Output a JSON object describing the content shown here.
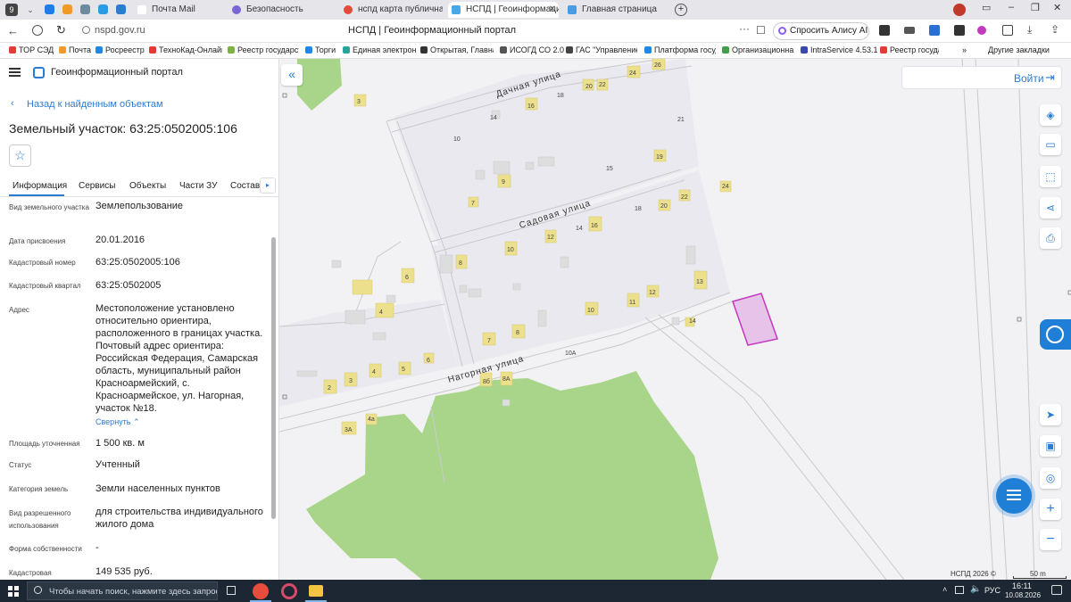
{
  "browser": {
    "tabs": [
      {
        "label": "Почта Mail",
        "color": "#1e7ee6"
      },
      {
        "label": "Безопасность",
        "color": "#7a66d6"
      },
      {
        "label": "нспд карта публичная ка",
        "color": "#e64a3a"
      },
      {
        "label": "НСПД | Геоинформаци",
        "color": "#4aa7e8"
      },
      {
        "label": "Главная страница",
        "color": "#4a9be0"
      }
    ],
    "address": "nspd.gov.ru",
    "page_title": "НСПД | Геоинформационный портал",
    "alice": "Спросить Алису AI",
    "bookmarks": [
      "ТОР СЭД",
      "Почта",
      "Росреестр",
      "ТехноКад-Онлайн",
      "Реестр государст",
      "Торги",
      "Единая электрон",
      "Открытая, Главна",
      "ИСОГД СО 2.0",
      "ГАС \"Управление",
      "Платформа госуд",
      "Организационна",
      "IntraService 4.53.1",
      "Реестр госуда"
    ],
    "bookmarks_more": "Другие закладки"
  },
  "panel": {
    "app_title": "Геоинформационный портал",
    "back": "Назад к найденным объектам",
    "object_title": "Земельный участок: 63:25:0502005:106",
    "tabs": [
      "Информация",
      "Сервисы",
      "Объекты",
      "Части ЗУ",
      "Состав"
    ],
    "active_tab": "Информация",
    "fields": [
      {
        "label": "Вид земельного участка",
        "value": "Землепользование"
      },
      {
        "label": "Дата присвоения",
        "value": "20.01.2016"
      },
      {
        "label": "Кадастровый номер",
        "value": "63:25:0502005:106"
      },
      {
        "label": "Кадастровый квартал",
        "value": "63:25:0502005"
      },
      {
        "label": "Адрес",
        "value": "Местоположение установлено относительно ориентира, расположенного в границах участка. Почтовый адрес ориентира: Российская Федерация, Самарская область, муниципальный район Красноармейский, с. Красноармейское, ул. Нагорная, участок №18."
      },
      {
        "label": "Площадь уточненная",
        "value": "1 500 кв. м"
      },
      {
        "label": "Статус",
        "value": "Учтенный"
      },
      {
        "label": "Категория земель",
        "value": "Земли населенных пунктов"
      },
      {
        "label": "Вид разрешенного использования",
        "value": "для строительства индивидуального жилого дома"
      },
      {
        "label": "Форма собственности",
        "value": "-"
      },
      {
        "label": "Кадастровая",
        "value": "149 535 руб."
      }
    ],
    "collapse": "Свернуть"
  },
  "map": {
    "login": "Войти",
    "streets": [
      "Дачная улица",
      "Садовая улица",
      "Нагорная улица"
    ],
    "house_numbers": [
      "3",
      "14",
      "16",
      "18",
      "20",
      "22",
      "24",
      "26",
      "21",
      "10",
      "15",
      "19",
      "9",
      "7",
      "22",
      "24",
      "18",
      "20",
      "12",
      "14",
      "16",
      "10",
      "8",
      "6",
      "4",
      "12",
      "13",
      "11",
      "10",
      "14",
      "8",
      "7",
      "6",
      "5",
      "4",
      "3",
      "2",
      "3А",
      "4а",
      "8б",
      "8А",
      "10А"
    ],
    "copyright": "НСПД 2026 ©",
    "scale": "50 m",
    "highlight_color": "#c23bbd"
  },
  "taskbar": {
    "search": "Чтобы начать поиск, нажмите здесь запрос",
    "lang": "РУС",
    "time": "16:11",
    "date": "10.08.2026"
  }
}
